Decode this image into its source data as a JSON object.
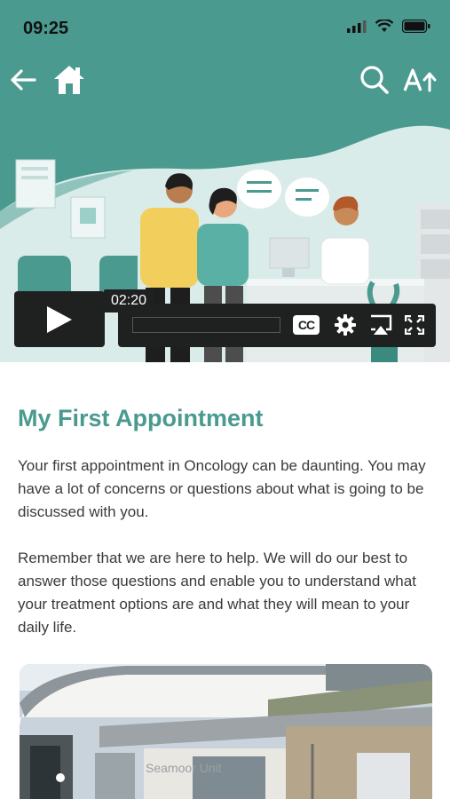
{
  "status": {
    "time": "09:25"
  },
  "nav": {
    "back_icon": "arrow-left-icon",
    "home_icon": "home-icon",
    "search_icon": "search-icon",
    "text_size_icon": "text-size-icon"
  },
  "video": {
    "time_label": "02:20",
    "cc_label": "CC",
    "progress_fraction": 0.0
  },
  "content": {
    "title": "My First Appointment",
    "paragraphs": [
      "Your first appointment in Oncology can be daunting. You may have a lot of concerns or questions about what is going to be discussed with you.",
      "Remember that we are here to help. We will do our best to answer those questions and enable you to understand what your treatment options are and what they will mean to your daily life."
    ]
  },
  "photo": {
    "sign_text": "Seamoor Unit"
  },
  "colors": {
    "brand": "#4a9a8f",
    "hero_bg": "#d9ecea",
    "player": "#1f2020"
  }
}
